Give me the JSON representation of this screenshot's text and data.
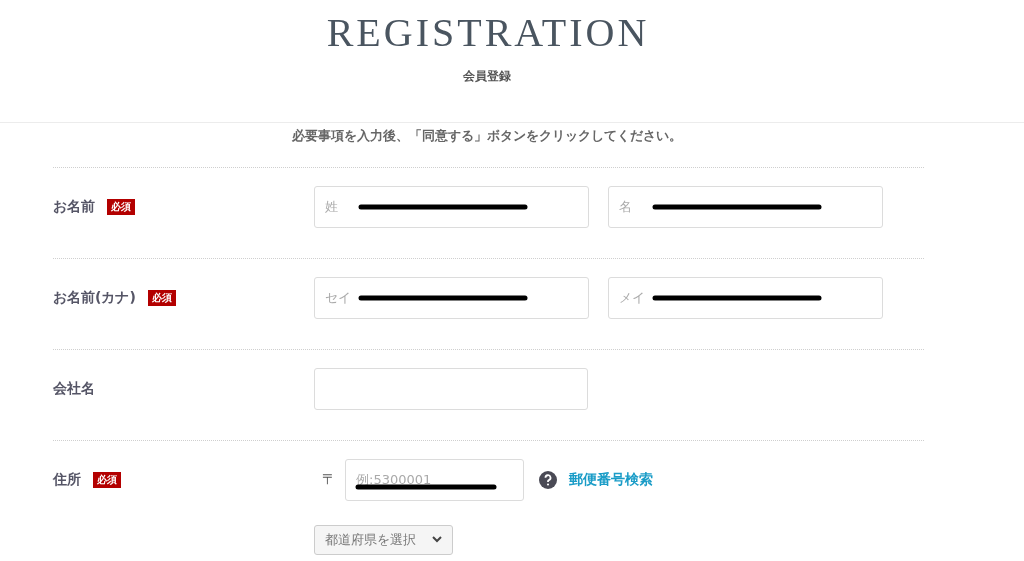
{
  "header": {
    "title": "REGISTRATION",
    "subtitle": "会員登録"
  },
  "instruction": "必要事項を入力後、「同意する」ボタンをクリックしてください。",
  "rows": [
    {
      "label": "お名前",
      "required": true,
      "badge": "必須",
      "kind": "pair",
      "fields": [
        {
          "placeholder": "姓",
          "redacted": true
        },
        {
          "placeholder": "名",
          "redacted": true
        }
      ]
    },
    {
      "label": "お名前(カナ)",
      "required": true,
      "badge": "必須",
      "kind": "pair",
      "fields": [
        {
          "placeholder": "セイ",
          "redacted": true
        },
        {
          "placeholder": "メイ",
          "redacted": true
        }
      ]
    },
    {
      "label": "会社名",
      "required": false,
      "kind": "single",
      "fields": [
        {
          "redacted": false
        }
      ]
    },
    {
      "label": "住所",
      "required": true,
      "badge": "必須",
      "kind": "address",
      "postal_mark": "〒",
      "fields": [
        {
          "placeholder": "例:5300001",
          "redacted": true
        }
      ],
      "lookup_link": "郵便番号検索",
      "prefecture_select": "都道府県を選択"
    }
  ]
}
